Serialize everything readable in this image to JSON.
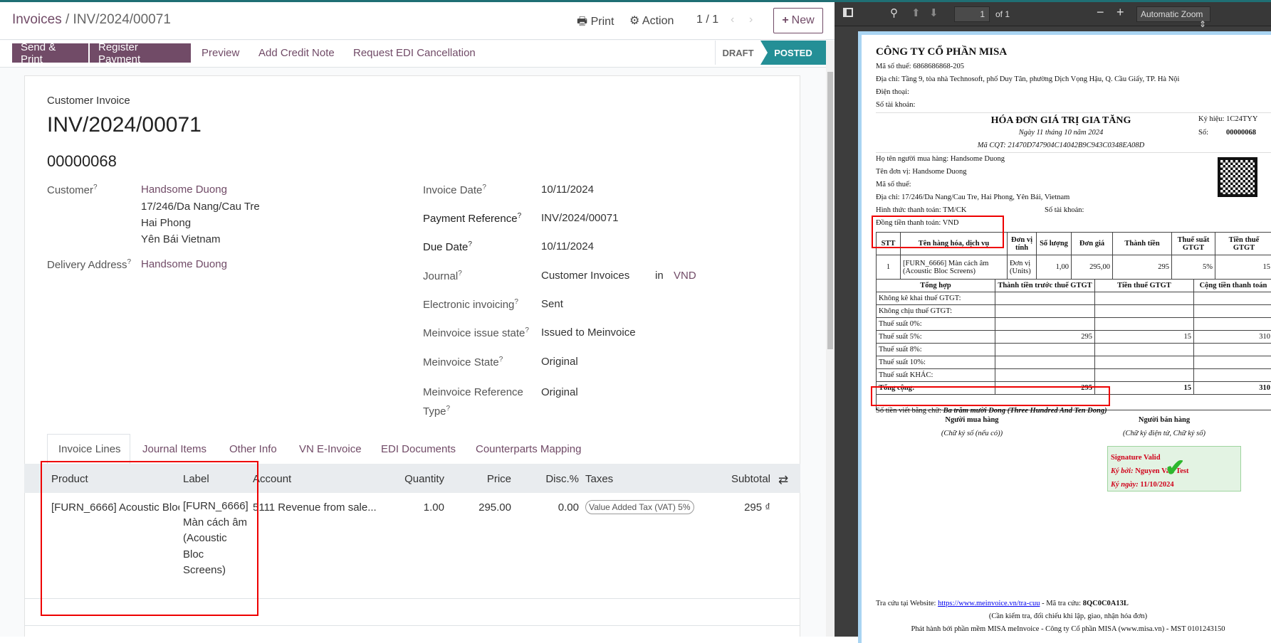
{
  "header": {
    "breadcrumb_root": "Invoices",
    "breadcrumb_sep": "/",
    "breadcrumb_current": "INV/2024/00071",
    "print": "Print",
    "action": "Action",
    "pager": "1 / 1",
    "new": "New"
  },
  "actions": {
    "send_print": "Send & Print",
    "register_payment": "Register Payment",
    "preview": "Preview",
    "add_credit_note": "Add Credit Note",
    "request_edi_cancel": "Request EDI Cancellation"
  },
  "status": {
    "draft": "DRAFT",
    "posted": "POSTED"
  },
  "form": {
    "type": "Customer Invoice",
    "name": "INV/2024/00071",
    "number": "00000068",
    "customer_label": "Customer",
    "customer": "Handsome Duong",
    "addr1": "17/246/Da Nang/Cau Tre",
    "addr2": "Hai Phong",
    "addr3": "Yên Bái Vietnam",
    "delivery_label": "Delivery Address",
    "delivery": "Handsome Duong",
    "invoice_date_label": "Invoice Date",
    "invoice_date": "10/11/2024",
    "payref_label": "Payment Reference",
    "payref": "INV/2024/00071",
    "due_label": "Due Date",
    "due": "10/11/2024",
    "journal_label": "Journal",
    "journal": "Customer Invoices",
    "in": "in",
    "currency": "VND",
    "einv_label": "Electronic invoicing",
    "einv": "Sent",
    "issue_label": "Meinvoice issue state",
    "issue": "Issued to Meinvoice",
    "mstate_label": "Meinvoice State",
    "mstate": "Original",
    "reftype_label": "Meinvoice Reference Type",
    "reftype": "Original",
    "q": "?"
  },
  "tabs": [
    "Invoice Lines",
    "Journal Items",
    "Other Info",
    "VN E-Invoice",
    "EDI Documents",
    "Counterparts Mapping"
  ],
  "lines": {
    "headers": [
      "Product",
      "Label",
      "Account",
      "Quantity",
      "Price",
      "Disc.%",
      "Taxes",
      "Subtotal"
    ],
    "row": {
      "product": "[FURN_6666] Acoustic Bloc",
      "label": "[FURN_6666] Màn cách âm (Acoustic Bloc Screens)",
      "account": "5111 Revenue from sale...",
      "qty": "1.00",
      "price": "295.00",
      "disc": "0.00",
      "tax": "Value Added Tax (VAT) 5%",
      "subtotal": "295 ₫"
    }
  },
  "pdf_toolbar": {
    "page": "1",
    "of": "of 1",
    "zoom": "Automatic Zoom"
  },
  "pdf": {
    "company": "CÔNG TY CỔ PHẦN MISA",
    "tax": "Mã số thuế: 6868686868-205",
    "address": "Địa chỉ: Tầng 9, tòa nhà Technosoft, phố Duy Tân, phường Dịch Vọng Hậu, Q. Cầu Giấy, TP. Hà Nội",
    "phone": "Điện thoại:",
    "account": "Số tài khoản:",
    "title": "HÓA ĐƠN GIÁ TRỊ GIA TĂNG",
    "date": "Ngày 11 tháng 10 năm 2024",
    "cqt": "Mã CQT: 21470D747904C14042B9C943C0348EA08D",
    "symbol": "Ký hiệu: 1C24TYY",
    "no_label": "Số:",
    "no": "00000068",
    "buyer": "Họ tên người mua hàng: Handsome Duong",
    "unit": "Tên đơn vị: Handsome Duong",
    "buyer_tax": "Mã số thuế:",
    "buyer_addr": "Địa chỉ: 17/246/Da Nang/Cau Tre, Hai Phong, Yên Bái, Vietnam",
    "payment": "Hình thức thanh toán: TM/CK",
    "buyer_acc": "Số tài khoản:",
    "currency": "Đồng tiền thanh toán: VND",
    "t1_headers": [
      "STT",
      "Tên hàng hóa, dịch vụ",
      "Đơn vị tính",
      "Số lượng",
      "Đơn giá",
      "Thành tiền",
      "Thuế suất GTGT",
      "Tiền thuế GTGT"
    ],
    "t1_row": [
      "1",
      "[FURN_6666] Màn cách âm (Acoustic Bloc Screens)",
      "Đơn vị (Units)",
      "1,00",
      "295,00",
      "295",
      "5%",
      "15"
    ],
    "t2_headers": [
      "Tổng hợp",
      "Thành tiền trước thuế GTGT",
      "Tiền thuế GTGT",
      "Cộng tiền thanh toán"
    ],
    "t2_rows": [
      [
        "Không kê khai thuế GTGT:",
        "",
        "",
        ""
      ],
      [
        "Không chịu thuế GTGT:",
        "",
        "",
        ""
      ],
      [
        "Thuế suất 0%:",
        "",
        "",
        ""
      ],
      [
        "Thuế suất 5%:",
        "295",
        "15",
        "310"
      ],
      [
        "Thuế suất 8%:",
        "",
        "",
        ""
      ],
      [
        "Thuế suất 10%:",
        "",
        "",
        ""
      ],
      [
        "Thuế suất KHÁC:",
        "",
        "",
        ""
      ],
      [
        "Tổng cộng:",
        "295",
        "15",
        "310"
      ]
    ],
    "words_label": "Số tiền viết bằng chữ:",
    "words": "Ba trăm mười Dong (Three Hundred And Ten Dong)",
    "buyer_sign": "Người mua hàng",
    "buyer_sign_note": "(Chữ ký số (nếu có))",
    "seller_sign": "Người bán hàng",
    "seller_sign_note": "(Chữ ký điện tử, Chữ ký số)",
    "sig_valid": "Signature Valid",
    "sig_by_label": "Ký bởi:",
    "sig_by": "Nguyen Van Test",
    "sig_date_label": "Ký ngày:",
    "sig_date": "11/10/2024",
    "lookup_label": "Tra cứu tại Website:",
    "lookup_url": "https://www.meinvoice.vn/tra-cuu",
    "lookup_code_label": "- Mã tra cứu:",
    "lookup_code": "8QC0C0A13L",
    "check_note": "(Cần kiểm tra, đối chiếu khi lập, giao, nhận hóa đơn)",
    "issuer": "Phát hành bởi phần mềm MISA meInvoice - Công ty Cổ phần MISA (www.misa.vn) - MST 0101243150"
  }
}
